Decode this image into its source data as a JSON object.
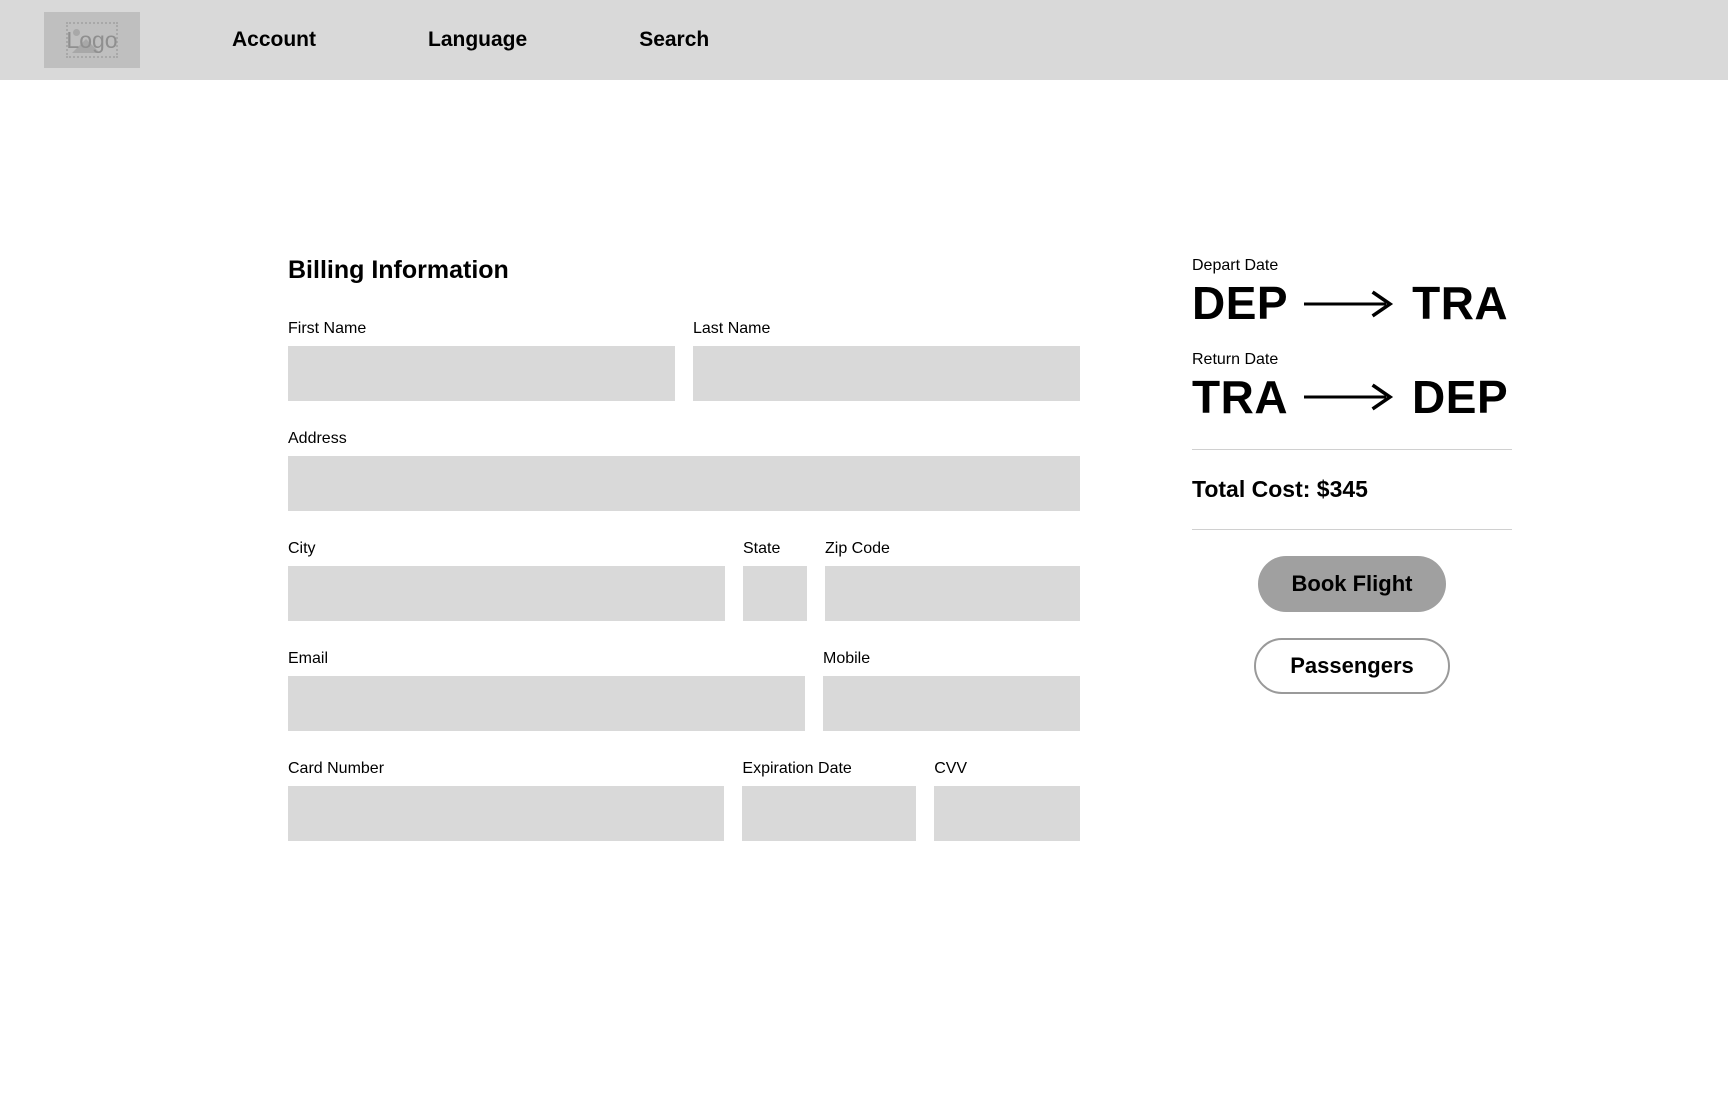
{
  "navbar": {
    "logo": {
      "text": "Logo",
      "icon": "image-placeholder-icon"
    },
    "links": [
      {
        "label": "Account"
      },
      {
        "label": "Language"
      },
      {
        "label": "Search"
      }
    ]
  },
  "billing": {
    "title": "Billing Information",
    "rows": [
      {
        "fields": [
          {
            "label": "First Name",
            "value": "",
            "placeholder": ""
          },
          {
            "label": "Last Name",
            "value": "",
            "placeholder": ""
          }
        ]
      },
      {
        "fields": [
          {
            "label": "Address",
            "value": "",
            "placeholder": ""
          }
        ]
      },
      {
        "fields": [
          {
            "label": "City",
            "value": "",
            "placeholder": ""
          },
          {
            "label": "State",
            "value": "",
            "placeholder": ""
          },
          {
            "label": "Zip Code",
            "value": "",
            "placeholder": ""
          }
        ]
      },
      {
        "fields": [
          {
            "label": "Email",
            "value": "",
            "placeholder": ""
          },
          {
            "label": "Mobile",
            "value": "",
            "placeholder": ""
          }
        ]
      },
      {
        "fields": [
          {
            "label": "Card Number",
            "value": "",
            "placeholder": ""
          },
          {
            "label": "Expiration Date",
            "value": "",
            "placeholder": ""
          },
          {
            "label": "CVV",
            "value": "",
            "placeholder": ""
          }
        ]
      }
    ]
  },
  "summary": {
    "depart": {
      "label": "Depart Date",
      "from": "DEP",
      "to": "TRA",
      "arrow_icon": "arrow-right-icon"
    },
    "return": {
      "label": "Return Date",
      "from": "TRA",
      "to": "DEP",
      "arrow_icon": "arrow-right-icon"
    },
    "total_cost": "Total Cost: $345",
    "book_button": "Book Flight",
    "passengers_button": "Passengers"
  },
  "colors": {
    "nav_background": "#d9d9d9",
    "input_fill": "#d9d9d9",
    "logo_box": "#bfbfbf",
    "primary_button": "#a0a0a0",
    "secondary_button_border": "#9a9a9a",
    "divider": "#d0d0d0",
    "page_background": "#ffffff",
    "text": "#000000"
  }
}
